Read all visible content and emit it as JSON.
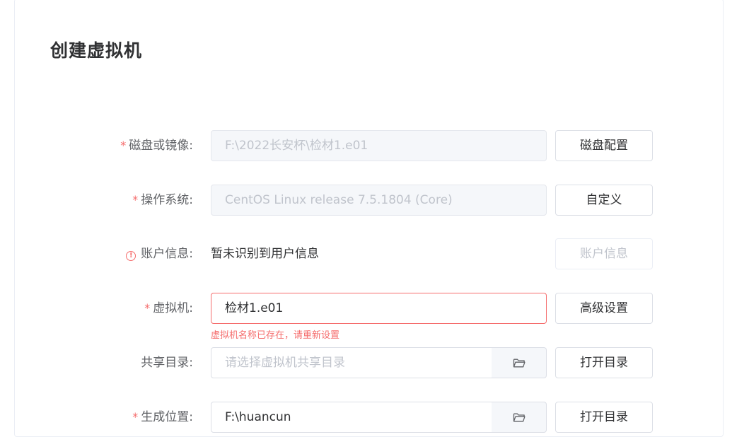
{
  "page": {
    "title": "创建虚拟机"
  },
  "form": {
    "disk": {
      "required_mark": "*",
      "label": "磁盘或镜像:",
      "value": "F:\\2022长安杯\\检材1.e01",
      "button": "磁盘配置"
    },
    "os": {
      "required_mark": "*",
      "label": "操作系统:",
      "value": "CentOS Linux release 7.5.1804 (Core)",
      "button": "自定义"
    },
    "account": {
      "warn_mark": "!",
      "label": "账户信息:",
      "value": "暂未识别到用户信息",
      "button": "账户信息"
    },
    "vm": {
      "required_mark": "*",
      "label": "虚拟机:",
      "value": "检材1.e01",
      "error": "虚拟机名称已存在，请重新设置",
      "button": "高级设置"
    },
    "share": {
      "label": "共享目录:",
      "placeholder": "请选择虚拟机共享目录",
      "button": "打开目录"
    },
    "output": {
      "required_mark": "*",
      "label": "生成位置:",
      "value": "F:\\huancun",
      "button": "打开目录"
    }
  },
  "icons": {
    "folder": "folder-icon",
    "warning": "warning-circle-icon"
  },
  "colors": {
    "required": "#f56c6c",
    "error": "#f56c6c",
    "disabled_bg": "#f5f7fa",
    "border": "#dcdfe6",
    "text": "#303133",
    "placeholder": "#c0c4cc"
  }
}
